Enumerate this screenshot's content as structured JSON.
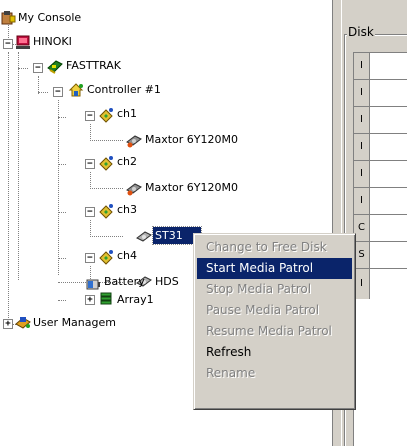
{
  "tree": {
    "root": "My Console",
    "server": "HINOKI",
    "product": "FASTTRAK",
    "controller": "Controller #1",
    "channels": [
      {
        "label": "ch1",
        "disk": "Maxtor 6Y120M0"
      },
      {
        "label": "ch2",
        "disk": "Maxtor 6Y120M0"
      },
      {
        "label": "ch3",
        "disk": "ST31"
      },
      {
        "label": "ch4",
        "disk": "HDS"
      }
    ],
    "battery": "Battery",
    "array": "Array1",
    "user_management": "User Managem"
  },
  "right_pane": {
    "group_title": "Disk",
    "row_markers": [
      "I",
      "I",
      "I",
      "I",
      "I",
      "I",
      "C",
      "S",
      "I"
    ]
  },
  "context_menu": {
    "items": [
      {
        "label": "Change to Free Disk",
        "enabled": false
      },
      {
        "label": "Start Media Patrol",
        "enabled": true,
        "highlighted": true
      },
      {
        "label": "Stop Media Patrol",
        "enabled": false
      },
      {
        "label": "Pause Media Patrol",
        "enabled": false
      },
      {
        "label": "Resume Media Patrol",
        "enabled": false
      },
      {
        "label": "Refresh",
        "enabled": true
      },
      {
        "label": "Rename",
        "enabled": false
      }
    ]
  },
  "colors": {
    "selection": "#0a246a",
    "menu_face": "#d4d0c8",
    "disabled_text": "#808080"
  }
}
